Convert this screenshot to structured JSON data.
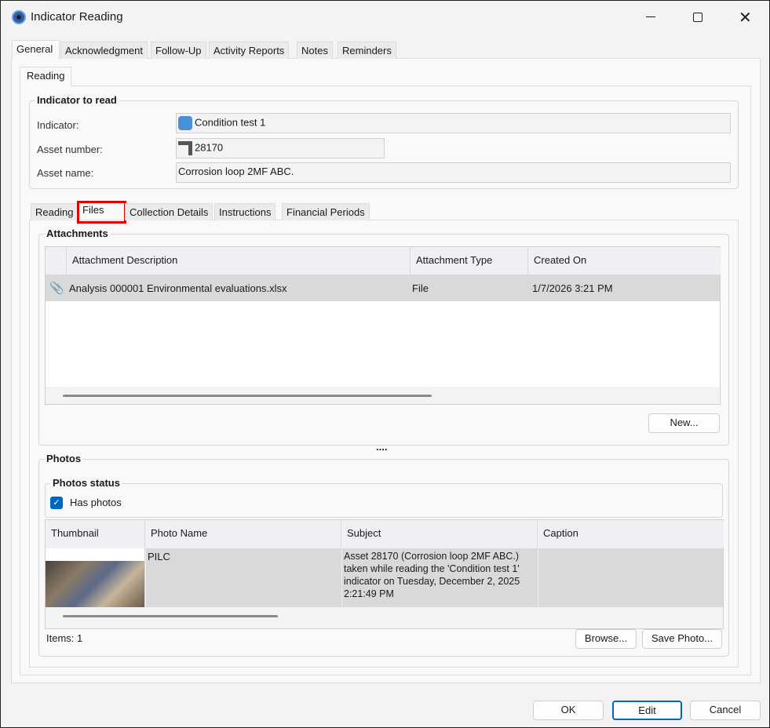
{
  "window": {
    "title": "Indicator Reading"
  },
  "main_tabs": [
    "General",
    "Acknowledgment",
    "Follow-Up",
    "Activity Reports",
    "Notes",
    "Reminders"
  ],
  "sub_tab": "Reading",
  "indicator_group": {
    "title": "Indicator to read",
    "indicator_label": "Indicator:",
    "indicator_value": "Condition test 1",
    "asset_number_label": "Asset number:",
    "asset_number_value": "28170",
    "asset_name_label": "Asset name:",
    "asset_name_value": "Corrosion loop 2MF ABC."
  },
  "inner_tabs": [
    "Reading",
    "Files",
    "Collection Details",
    "Instructions",
    "Financial Periods"
  ],
  "attachments": {
    "title": "Attachments",
    "columns": [
      "Attachment Description",
      "Attachment Type",
      "Created On"
    ],
    "rows": [
      {
        "description": "Analysis 000001 Environmental evaluations.xlsx",
        "type": "File",
        "created": "1/7/2026 3:21 PM"
      }
    ],
    "new_button": "New..."
  },
  "splitter": "....",
  "photos": {
    "title": "Photos",
    "status_title": "Photos status",
    "has_photos_label": "Has photos",
    "has_photos": true,
    "columns": [
      "Thumbnail",
      "Photo Name",
      "Subject",
      "Caption"
    ],
    "rows": [
      {
        "name": "PILC",
        "subject": "Asset 28170 (Corrosion loop 2MF ABC.) taken while reading the 'Condition test 1' indicator on Tuesday, December 2, 2025 2:21:49 PM",
        "caption": ""
      }
    ],
    "items_label": "Items: 1",
    "browse_button": "Browse...",
    "save_button": "Save Photo..."
  },
  "footer": {
    "ok": "OK",
    "edit": "Edit",
    "cancel": "Cancel"
  },
  "colors": {
    "highlight": "#e00000",
    "accent": "#0067c0"
  }
}
